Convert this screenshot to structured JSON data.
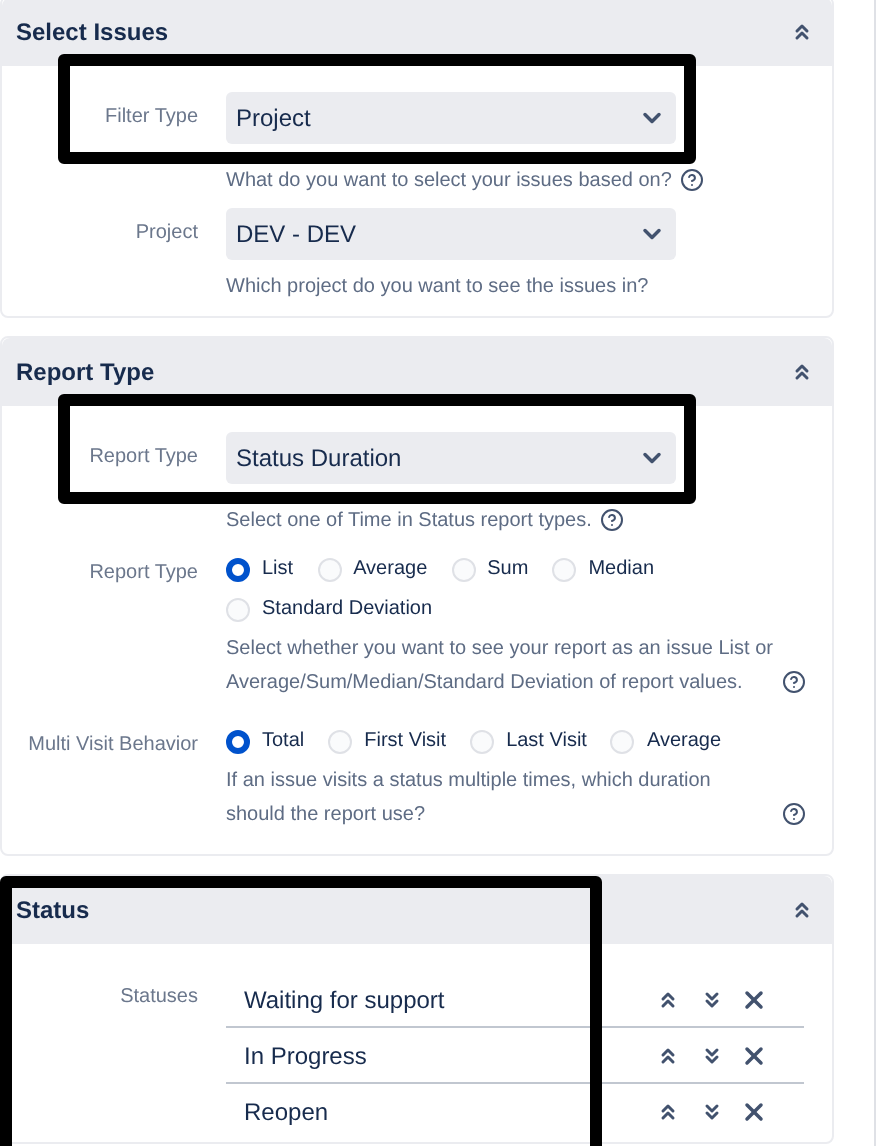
{
  "sections": [
    {
      "title": "Select Issues",
      "expanded": true,
      "highlighted": false,
      "fields": [
        {
          "kind": "select",
          "label": "Filter Type",
          "value": "Project",
          "highlighted": true,
          "help": "What do you want to select your issues based on?",
          "help_icon": true
        },
        {
          "kind": "select",
          "label": "Project",
          "value": "DEV - DEV",
          "highlighted": false,
          "help": "Which project do you want to see the issues in?",
          "help_icon": false
        }
      ]
    },
    {
      "title": "Report Type",
      "expanded": true,
      "highlighted": false,
      "fields": [
        {
          "kind": "select",
          "label": "Report Type",
          "value": "Status Duration",
          "highlighted": true,
          "help": "Select one of Time in Status report types.",
          "help_icon": true
        },
        {
          "kind": "radio",
          "label": "Report Type",
          "options": [
            {
              "label": "List",
              "selected": true
            },
            {
              "label": "Average",
              "selected": false
            },
            {
              "label": "Sum",
              "selected": false
            },
            {
              "label": "Median",
              "selected": false
            },
            {
              "label": "Standard Deviation",
              "selected": false
            }
          ],
          "help": "Select whether you want to see your report as an issue List or Average/Sum/Median/Standard Deviation of report values.",
          "help_icon": true
        },
        {
          "kind": "radio",
          "label": "Multi Visit Behavior",
          "options": [
            {
              "label": "Total",
              "selected": true
            },
            {
              "label": "First Visit",
              "selected": false
            },
            {
              "label": "Last Visit",
              "selected": false
            },
            {
              "label": "Average",
              "selected": false
            }
          ],
          "help": "If an issue visits a status multiple times, which duration should the report use?",
          "help_icon": true
        }
      ]
    },
    {
      "title": "Status",
      "expanded": true,
      "highlighted": true,
      "fields": [
        {
          "kind": "list",
          "label": "Statuses",
          "items": [
            "Waiting for support",
            "In Progress",
            "Reopen"
          ]
        }
      ]
    }
  ]
}
